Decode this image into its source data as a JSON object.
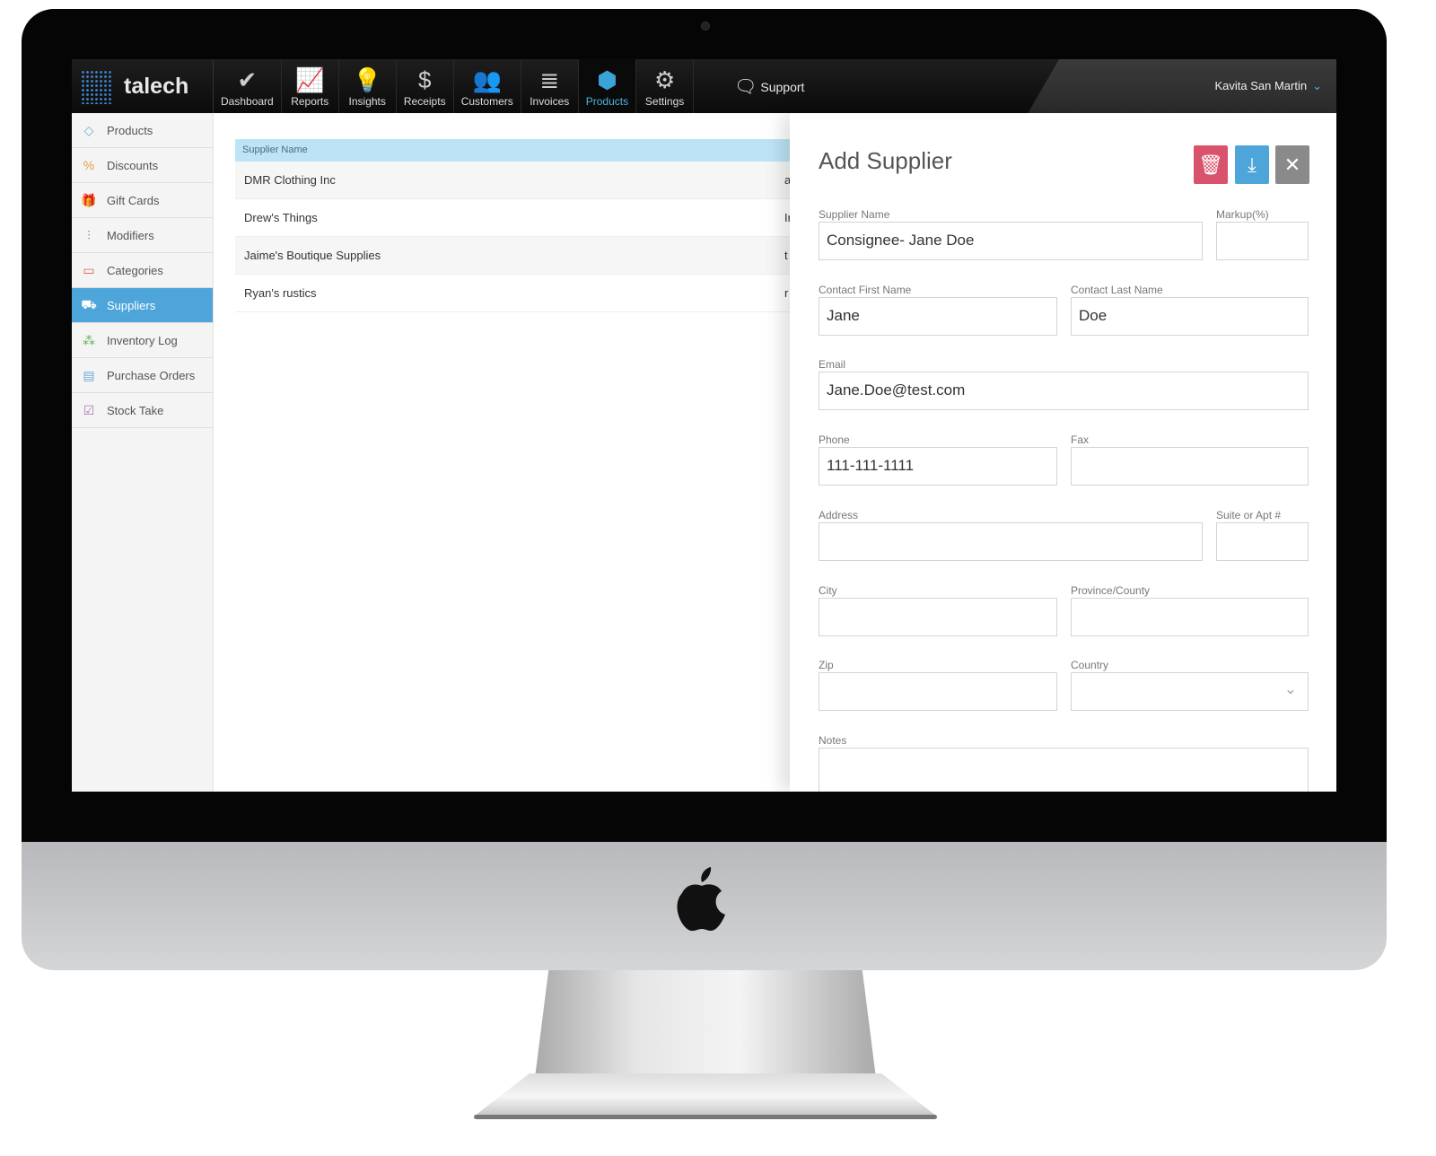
{
  "app": {
    "logo": "talech",
    "user": "Kavita San Martin"
  },
  "nav": [
    {
      "label": "Dashboard",
      "icon": "checkmark-badge-icon",
      "glyph": "✔"
    },
    {
      "label": "Reports",
      "icon": "line-chart-icon",
      "glyph": "📈"
    },
    {
      "label": "Insights",
      "icon": "lightbulb-icon",
      "glyph": "💡"
    },
    {
      "label": "Receipts",
      "icon": "receipt-icon",
      "glyph": "$"
    },
    {
      "label": "Customers",
      "icon": "customers-icon",
      "glyph": "👥"
    },
    {
      "label": "Invoices",
      "icon": "document-icon",
      "glyph": "≣"
    },
    {
      "label": "Products",
      "icon": "box-icon",
      "glyph": "⬢",
      "active": true
    },
    {
      "label": "Settings",
      "icon": "gears-icon",
      "glyph": "⚙"
    }
  ],
  "support": {
    "label": "Support",
    "icon": "chat-support-icon"
  },
  "sidebar": [
    {
      "label": "Products",
      "icon": "box-icon",
      "glyph": "◇",
      "color": "#6aaed6"
    },
    {
      "label": "Discounts",
      "icon": "percent-tag-icon",
      "glyph": "%",
      "color": "#e0a040"
    },
    {
      "label": "Gift Cards",
      "icon": "gift-icon",
      "glyph": "🎁",
      "color": "#60b060"
    },
    {
      "label": "Modifiers",
      "icon": "sliders-icon",
      "glyph": "⫶",
      "color": "#9a4aa0"
    },
    {
      "label": "Categories",
      "icon": "folder-icon",
      "glyph": "▭",
      "color": "#e06040"
    },
    {
      "label": "Suppliers",
      "icon": "truck-icon",
      "glyph": "⛟",
      "color": "#ffffff",
      "active": true
    },
    {
      "label": "Inventory Log",
      "icon": "boxes-icon",
      "glyph": "⁂",
      "color": "#60b060"
    },
    {
      "label": "Purchase Orders",
      "icon": "order-doc-icon",
      "glyph": "▤",
      "color": "#6aaed6"
    },
    {
      "label": "Stock Take",
      "icon": "clipboard-icon",
      "glyph": "☑",
      "color": "#b070b0"
    }
  ],
  "table": {
    "header": "Supplier Name",
    "rows": [
      {
        "name": "DMR Clothing Inc",
        "col2": "a"
      },
      {
        "name": "Drew's Things",
        "col2": "Ir"
      },
      {
        "name": "Jaime's Boutique Supplies",
        "col2": "t"
      },
      {
        "name": "Ryan's rustics",
        "col2": "r"
      }
    ]
  },
  "panel": {
    "title": "Add Supplier",
    "colors": {
      "delete": "#d9536c",
      "save": "#4ea5d9",
      "close": "#8a8a8a"
    },
    "fields": {
      "supplier_name": {
        "label": "Supplier Name",
        "value": "Consignee- Jane Doe"
      },
      "markup": {
        "label": "Markup(%)",
        "value": ""
      },
      "first_name": {
        "label": "Contact First Name",
        "value": "Jane"
      },
      "last_name": {
        "label": "Contact Last Name",
        "value": "Doe"
      },
      "email": {
        "label": "Email",
        "value": "Jane.Doe@test.com"
      },
      "phone": {
        "label": "Phone",
        "value": "111-111-1111"
      },
      "fax": {
        "label": "Fax",
        "value": ""
      },
      "address": {
        "label": "Address",
        "value": ""
      },
      "suite": {
        "label": "Suite or Apt #",
        "value": ""
      },
      "city": {
        "label": "City",
        "value": ""
      },
      "province": {
        "label": "Province/County",
        "value": ""
      },
      "zip": {
        "label": "Zip",
        "value": ""
      },
      "country": {
        "label": "Country",
        "value": ""
      },
      "notes": {
        "label": "Notes",
        "value": ""
      }
    }
  }
}
